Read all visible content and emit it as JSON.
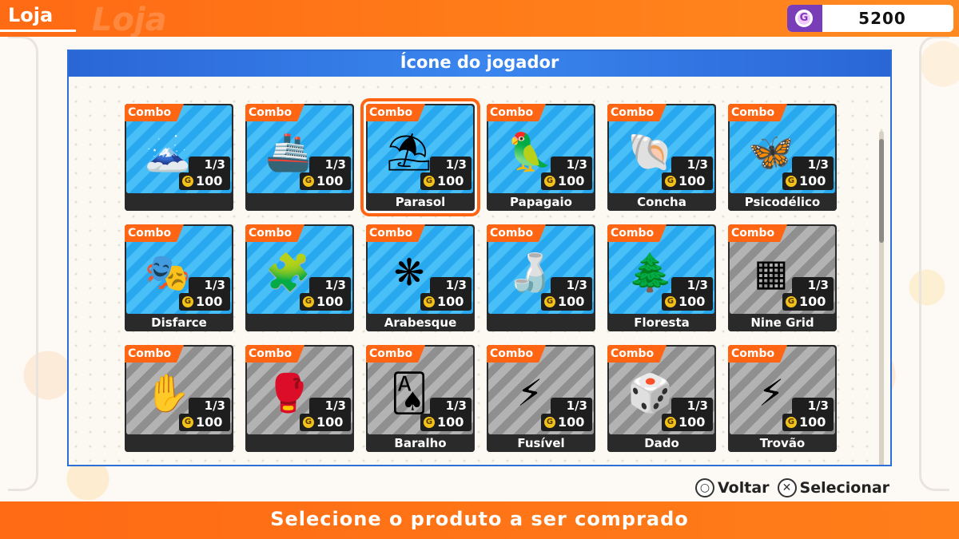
{
  "header": {
    "title": "Loja",
    "ghost_text": "Loja"
  },
  "currency": {
    "icon": "g-coin-icon",
    "value": "5200"
  },
  "panel": {
    "title": "Ícone do jogador"
  },
  "items": [
    {
      "tag": "Combo",
      "count": "1/3",
      "price": "100",
      "name": "",
      "icon": "🗻",
      "style": "blue"
    },
    {
      "tag": "Combo",
      "count": "1/3",
      "price": "100",
      "name": "",
      "icon": "🚢",
      "style": "blue"
    },
    {
      "tag": "Combo",
      "count": "1/3",
      "price": "100",
      "name": "Parasol",
      "icon": "⛱",
      "style": "blue",
      "selected": true
    },
    {
      "tag": "Combo",
      "count": "1/3",
      "price": "100",
      "name": "Papagaio",
      "icon": "🦜",
      "style": "blue"
    },
    {
      "tag": "Combo",
      "count": "1/3",
      "price": "100",
      "name": "Concha",
      "icon": "🐚",
      "style": "blue"
    },
    {
      "tag": "Combo",
      "count": "1/3",
      "price": "100",
      "name": "Psicodélico",
      "icon": "🦋",
      "style": "blue"
    },
    {
      "tag": "Combo",
      "count": "1/3",
      "price": "100",
      "name": "Disfarce",
      "icon": "🎭",
      "style": "blue"
    },
    {
      "tag": "Combo",
      "count": "1/3",
      "price": "100",
      "name": "",
      "icon": "🧩",
      "style": "blue"
    },
    {
      "tag": "Combo",
      "count": "1/3",
      "price": "100",
      "name": "Arabesque",
      "icon": "❋",
      "style": "blue"
    },
    {
      "tag": "Combo",
      "count": "1/3",
      "price": "100",
      "name": "",
      "icon": "🍶",
      "style": "blue"
    },
    {
      "tag": "Combo",
      "count": "1/3",
      "price": "100",
      "name": "Floresta",
      "icon": "🌲",
      "style": "blue"
    },
    {
      "tag": "Combo",
      "count": "1/3",
      "price": "100",
      "name": "Nine Grid",
      "icon": "▦",
      "style": "gray"
    },
    {
      "tag": "Combo",
      "count": "1/3",
      "price": "100",
      "name": "",
      "icon": "✋",
      "style": "gray"
    },
    {
      "tag": "Combo",
      "count": "1/3",
      "price": "100",
      "name": "",
      "icon": "🥊",
      "style": "gray"
    },
    {
      "tag": "Combo",
      "count": "1/3",
      "price": "100",
      "name": "Baralho",
      "icon": "🂡",
      "style": "gray"
    },
    {
      "tag": "Combo",
      "count": "1/3",
      "price": "100",
      "name": "Fusível",
      "icon": "⚡",
      "style": "gray"
    },
    {
      "tag": "Combo",
      "count": "1/3",
      "price": "100",
      "name": "Dado",
      "icon": "🎲",
      "style": "gray"
    },
    {
      "tag": "Combo",
      "count": "1/3",
      "price": "100",
      "name": "Trovão",
      "icon": "⚡",
      "style": "gray"
    }
  ],
  "hints": [
    {
      "glyph": "○",
      "label": "Voltar",
      "icon": "circle-button-icon"
    },
    {
      "glyph": "✕",
      "label": "Selecionar",
      "icon": "cross-button-icon"
    }
  ],
  "footer": {
    "text": "Selecione o produto a ser comprado"
  },
  "colors": {
    "accent": "#ff6512",
    "panel_head": "#2a66d6",
    "coin": "#7a3db8"
  }
}
